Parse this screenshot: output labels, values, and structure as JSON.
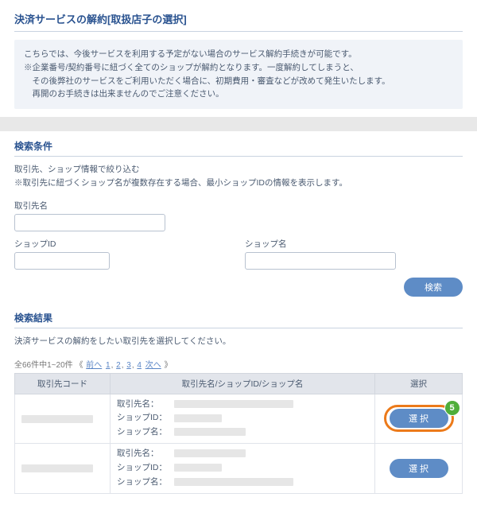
{
  "title": "決済サービスの解約[取扱店子の選択]",
  "info_lines": [
    "こちらでは、今後サービスを利用する予定がない場合のサービス解約手続きが可能です。",
    "※企業番号/契約番号に紐づく全てのショップが解約となります。一度解約してしまうと、",
    "　その後弊社のサービスをご利用いただく場合に、初期費用・審査などが改めて発生いたします。",
    "　再開のお手続きは出来ませんのでご注意ください。"
  ],
  "search": {
    "section_title": "検索条件",
    "desc_line1": "取引先、ショップ情報で絞り込む",
    "desc_line2": "※取引先に紐づくショップ名が複数存在する場合、最小ショップIDの情報を表示します。",
    "partner_label": "取引先名",
    "shop_id_label": "ショップID",
    "shop_name_label": "ショップ名",
    "partner_value": "",
    "shop_id_value": "",
    "shop_name_value": "",
    "search_btn": "検索"
  },
  "results": {
    "section_title": "検索結果",
    "desc": "決済サービスの解約をしたい取引先を選択してください。",
    "pager_total": "全66件中1~20件",
    "pager_prev": "前へ",
    "pager_pages": [
      "1",
      "2",
      "3",
      "4"
    ],
    "pager_next": "次へ",
    "col_code": "取引先コード",
    "col_info": "取引先名/ショップID/ショップ名",
    "col_select": "選択",
    "row_partner_key": "取引先名：",
    "row_shopid_key": "ショップID：",
    "row_shopname_key": "ショップ名：",
    "select_btn": "選 択",
    "highlight_badge": "5"
  }
}
